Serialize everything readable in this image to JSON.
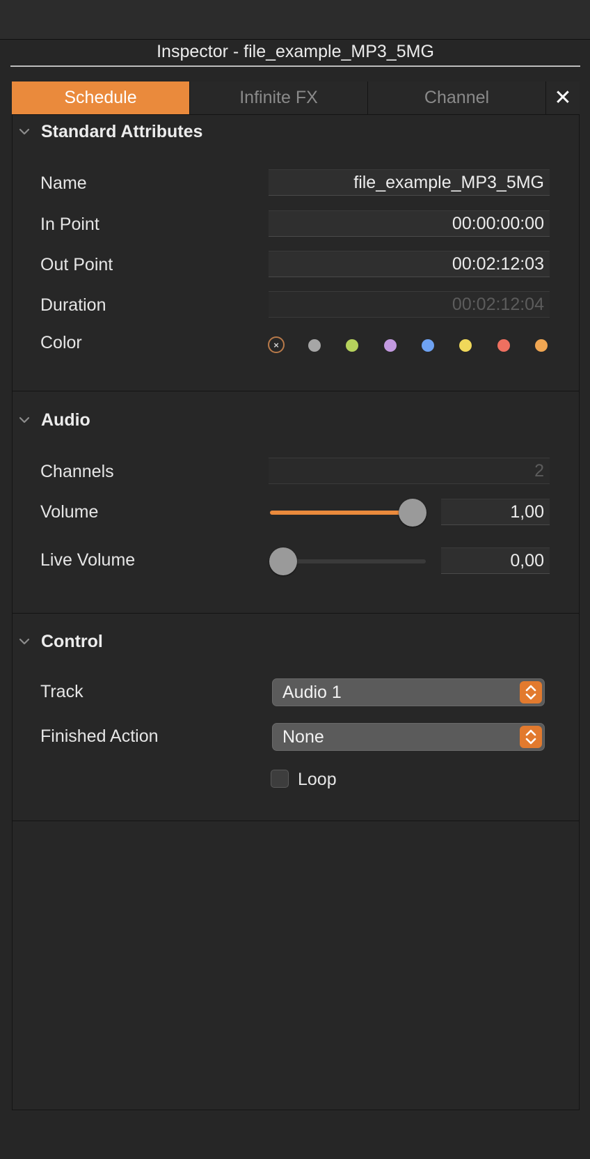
{
  "window": {
    "title": "Inspector - file_example_MP3_5MG"
  },
  "tabs": [
    {
      "label": "Schedule",
      "active": true
    },
    {
      "label": "Infinite FX",
      "active": false
    },
    {
      "label": "Channel",
      "active": false
    }
  ],
  "close_glyph": "✕",
  "standard_attributes": {
    "header": "Standard Attributes",
    "name_label": "Name",
    "name_value": "file_example_MP3_5MG",
    "in_point_label": "In Point",
    "in_point_value": "00:00:00:00",
    "out_point_label": "Out Point",
    "out_point_value": "00:02:12:03",
    "duration_label": "Duration",
    "duration_value": "00:02:12:04",
    "color_label": "Color",
    "color_none_glyph": "×",
    "colors": [
      "#a6a6a6",
      "#b6d25c",
      "#c39ae0",
      "#6ea2f2",
      "#f0d85a",
      "#ee7060",
      "#f0a652"
    ]
  },
  "audio": {
    "header": "Audio",
    "channels_label": "Channels",
    "channels_value": "2",
    "volume_label": "Volume",
    "volume_value": "1,00",
    "volume_level": 1.0,
    "live_volume_label": "Live Volume",
    "live_volume_value": "0,00",
    "live_volume_level": 0.0
  },
  "control": {
    "header": "Control",
    "track_label": "Track",
    "track_value": "Audio 1",
    "finished_action_label": "Finished Action",
    "finished_action_value": "None",
    "loop_label": "Loop",
    "loop_checked": false
  },
  "accent_color": "#ea8a3c"
}
